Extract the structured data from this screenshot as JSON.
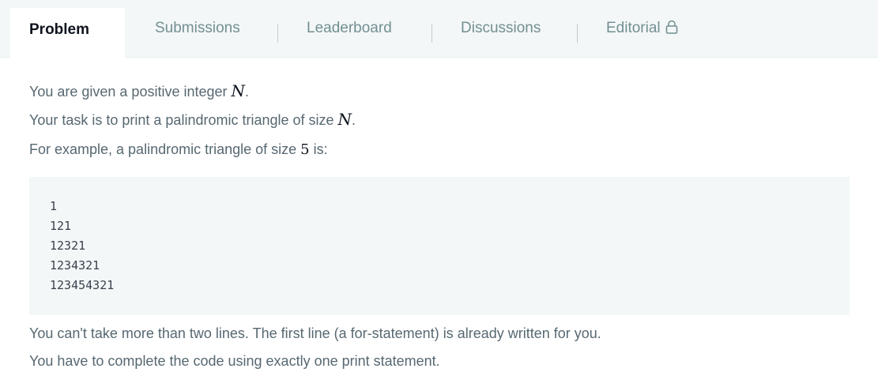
{
  "tabs": {
    "problem": "Problem",
    "submissions": "Submissions",
    "leaderboard": "Leaderboard",
    "discussions": "Discussions",
    "editorial": "Editorial"
  },
  "icons": {
    "editorial_lock": "lock-icon"
  },
  "problem": {
    "line1_text": "You are given a positive integer ",
    "line1_var": "N",
    "line1_end": ".",
    "line2_text": "Your task is to print a palindromic triangle of size ",
    "line2_var": "N",
    "line2_end": ".",
    "line3_text": "For example, a palindromic triangle of size ",
    "line3_num": "5",
    "line3_end": " is:",
    "example": [
      "1",
      "121",
      "12321",
      "1234321",
      "123454321"
    ],
    "line4": "You can't take more than two lines. The first line (a for-statement) is already written for you.",
    "line5": "You have to complete the code using exactly one print statement."
  },
  "colors": {
    "tabbar_bg": "#f3f7f7",
    "active_tab_text": "#0e141e",
    "inactive_tab_text": "#738f93",
    "body_text": "#576871",
    "code_bg": "#f3f7f7"
  }
}
